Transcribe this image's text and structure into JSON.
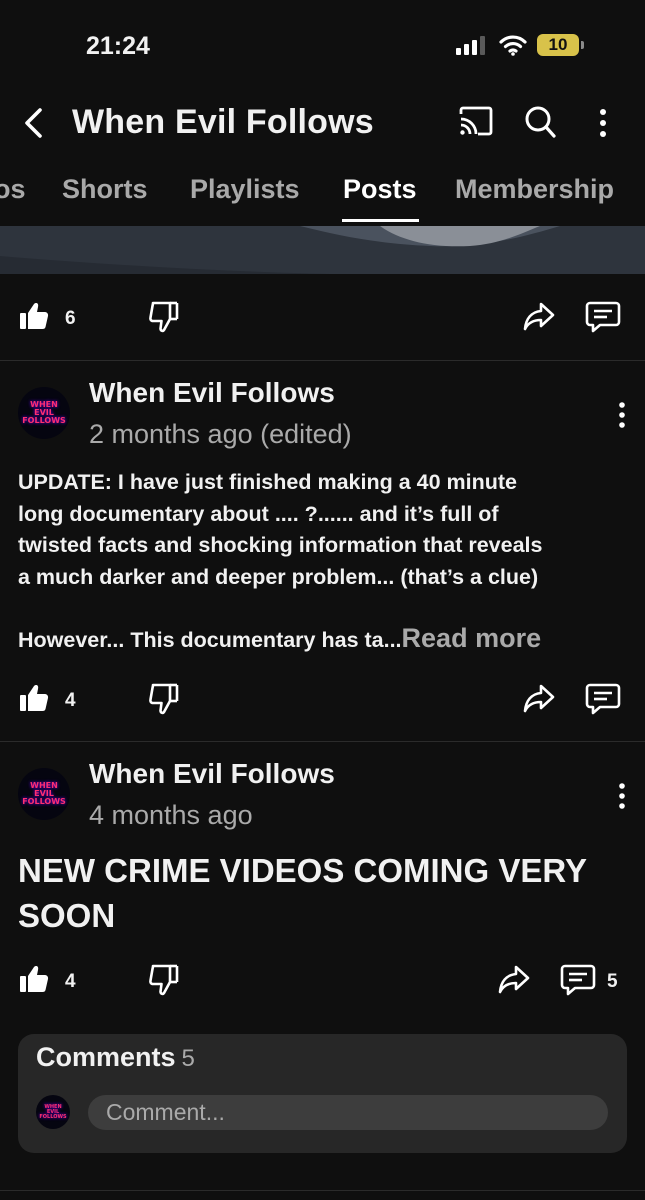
{
  "status_bar": {
    "time": "21:24",
    "battery": "10"
  },
  "header": {
    "title": "When Evil Follows"
  },
  "tabs": [
    {
      "label": "os"
    },
    {
      "label": "Shorts"
    },
    {
      "label": "Playlists"
    },
    {
      "label": "Posts",
      "active": true
    },
    {
      "label": "Membership"
    }
  ],
  "posts": [
    {
      "likes": "6"
    },
    {
      "avatar_text": [
        "WHEN",
        "EVIL",
        "FOLLOWS"
      ],
      "author": "When Evil Follows",
      "time": "2 months ago (edited)",
      "body_lines": [
        "UPDATE: I have just finished making a 40 minute",
        "long documentary about .... ?...... and it’s full of",
        "twisted facts and shocking information that reveals",
        "a much darker and deeper problem... (that’s a clue)"
      ],
      "body_truncated": "However... This documentary has ta...",
      "read_more": "Read more",
      "likes": "4"
    },
    {
      "avatar_text": [
        "WHEN",
        "EVIL",
        "FOLLOWS"
      ],
      "author": "When Evil Follows",
      "time": "4 months ago",
      "body_lines": [
        "NEW CRIME VIDEOS COMING VERY",
        "SOON"
      ],
      "likes": "4",
      "comments": "5"
    }
  ],
  "comments_box": {
    "title": "Comments",
    "count": "5",
    "placeholder": "Comment..."
  },
  "colors": {
    "background": "#0f0f0f",
    "text": "#f1f1f1",
    "secondary": "#aaaaaa",
    "card": "#272727"
  }
}
